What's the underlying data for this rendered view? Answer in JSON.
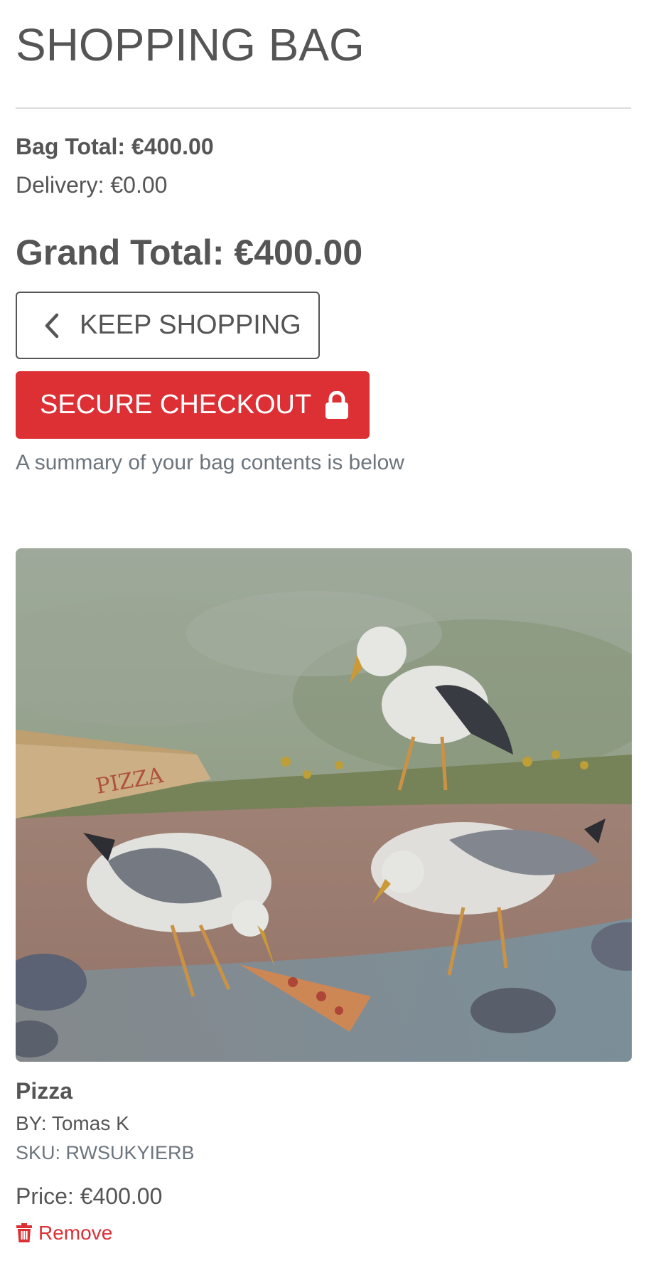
{
  "page": {
    "title": "SHOPPING BAG"
  },
  "totals": {
    "bag_total": "Bag Total: €400.00",
    "delivery": "Delivery: €0.00",
    "grand_total": "Grand Total: €400.00"
  },
  "actions": {
    "keep_shopping_label": "KEEP SHOPPING",
    "keep_shopping_icon": "chevron-left-icon",
    "checkout_label": "SECURE CHECKOUT",
    "checkout_icon": "lock-icon",
    "summary_note": "A summary of your bag contents is below"
  },
  "items": [
    {
      "name": "Pizza",
      "artist": "BY: Tomas K",
      "sku": "SKU: RWSUKYIERB",
      "price": "Price: €400.00",
      "remove_label": "Remove",
      "remove_icon": "trash-icon"
    }
  ],
  "colors": {
    "text": "#555555",
    "muted": "#6c757d",
    "accent_red": "#dc3035",
    "divider": "#dcdcdc"
  }
}
